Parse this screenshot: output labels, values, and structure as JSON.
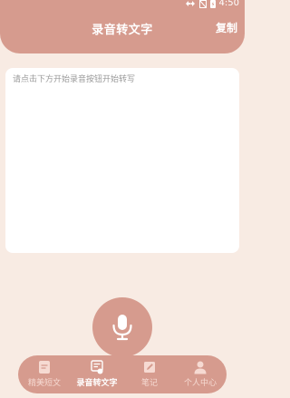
{
  "status_bar": {
    "time": "4:50",
    "icons": [
      "data-arrows-icon",
      "no-signal-icon",
      "battery-icon"
    ]
  },
  "header": {
    "title": "录音转文字",
    "copy_label": "复制"
  },
  "editor": {
    "placeholder": "请点击下方开始录音按钮开始转写",
    "value": ""
  },
  "record_button": {
    "icon": "microphone-icon"
  },
  "tabs": [
    {
      "label": "精美短文",
      "icon": "document-icon",
      "active": false
    },
    {
      "label": "录音转文字",
      "icon": "record-to-text-icon",
      "active": true
    },
    {
      "label": "笔记",
      "icon": "note-edit-icon",
      "active": false
    },
    {
      "label": "个人中心",
      "icon": "person-icon",
      "active": false
    }
  ],
  "colors": {
    "primary": "#d69b8e",
    "background": "#f8ebe3",
    "card": "#ffffff",
    "placeholder": "#9a9a9a",
    "inactive_tab": "#f6dad2"
  }
}
